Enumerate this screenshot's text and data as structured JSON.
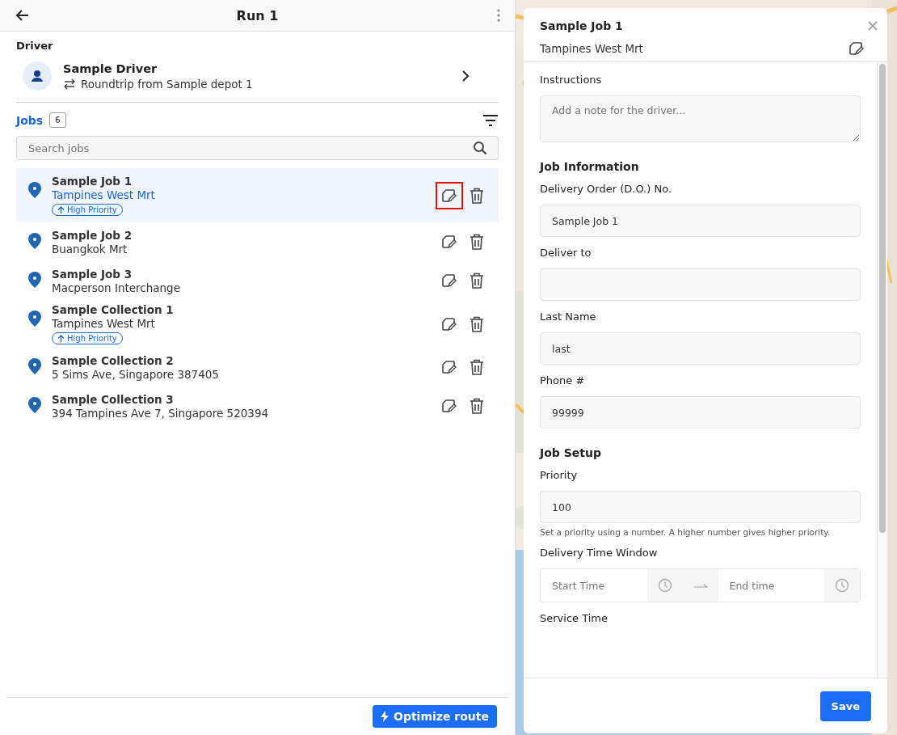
{
  "header": {
    "title": "Run 1"
  },
  "driver": {
    "heading": "Driver",
    "name": "Sample Driver",
    "route": "Roundtrip from Sample depot 1"
  },
  "jobs": {
    "label": "Jobs",
    "count": "6",
    "search_placeholder": "Search jobs",
    "items": [
      {
        "title": "Sample Job 1",
        "address": "Tampines West Mrt",
        "badge": "High Priority",
        "selected": true,
        "edit_highlighted": true
      },
      {
        "title": "Sample Job 2",
        "address": "Buangkok Mrt",
        "selected": false,
        "edit_highlighted": false
      },
      {
        "title": "Sample Job 3",
        "address": "Macperson Interchange",
        "selected": false,
        "edit_highlighted": false
      },
      {
        "title": "Sample Collection 1",
        "address": "Tampines West Mrt",
        "badge": "High Priority",
        "selected": false,
        "edit_highlighted": false
      },
      {
        "title": "Sample Collection 2",
        "address": "5 Sims Ave, Singapore 387405",
        "selected": false,
        "edit_highlighted": false
      },
      {
        "title": "Sample Collection 3",
        "address": "394 Tampines Ave 7, Singapore 520394",
        "selected": false,
        "edit_highlighted": false
      }
    ]
  },
  "optimize_button": "Optimize route",
  "detail": {
    "title": "Sample Job 1",
    "subtitle": "Tampines West Mrt",
    "form": [
      {
        "kind": "label",
        "text": "Instructions"
      },
      {
        "kind": "textarea",
        "placeholder": "Add a note for the driver..."
      },
      {
        "kind": "section",
        "text": "Job Information"
      },
      {
        "kind": "label",
        "text": "Delivery Order (D.O.) No."
      },
      {
        "kind": "input",
        "value": "Sample Job 1"
      },
      {
        "kind": "label",
        "text": "Deliver to"
      },
      {
        "kind": "input"
      },
      {
        "kind": "label",
        "text": "Last Name"
      },
      {
        "kind": "input",
        "value": "last"
      },
      {
        "kind": "label",
        "text": "Phone #"
      },
      {
        "kind": "input",
        "value": "99999"
      },
      {
        "kind": "section",
        "text": "Job Setup"
      },
      {
        "kind": "label",
        "text": "Priority"
      },
      {
        "kind": "input",
        "value": "100"
      },
      {
        "kind": "help",
        "text": "Set a priority using a number. A higher number gives higher priority."
      },
      {
        "kind": "label",
        "text": "Delivery Time Window"
      },
      {
        "kind": "time_range",
        "start_placeholder": "Start Time",
        "end_placeholder": "End time"
      },
      {
        "kind": "label",
        "text": "Service Time"
      }
    ],
    "save_button": "Save"
  }
}
